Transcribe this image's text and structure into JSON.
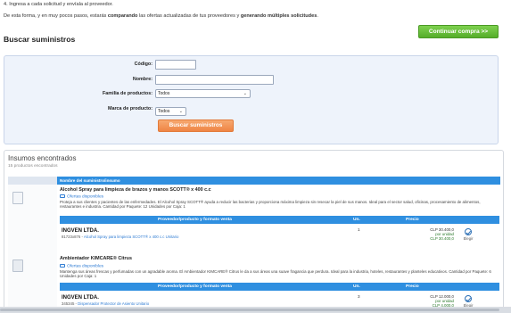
{
  "intro": {
    "step4": "4. Ingresa a cada solicitud y envíala al proveedor.",
    "line2_a": "De esta forma, y en muy pocos pasos, estarás ",
    "line2_b": "comparando",
    "line2_c": " las ofertas actualizadas de tus proveedores y ",
    "line2_d": "generando múltiples solicitudes",
    "line2_e": "."
  },
  "cta_button": "Continuar compra >>",
  "section_title": "Buscar suministros",
  "search_form": {
    "codigo_label": "Código:",
    "codigo_value": "",
    "nombre_label": "Nombre:",
    "nombre_value": "",
    "familia_label": "Familia de productos:",
    "familia_value": "Todos",
    "marca_label": "Marca de producto:",
    "marca_value": "Todos",
    "search_button": "Buscar suministros"
  },
  "results": {
    "title": "Insumos encontrados",
    "count": "15 productos encontrados",
    "column_header": "Nombre del suministro/insumo",
    "sub_headers": {
      "provider": "Proveedor/producto y formato venta",
      "unit": "Un.",
      "price": "Precio"
    },
    "products": [
      {
        "title": "Alcohol Spray para limpieza de brazos y manos SCOTT® x 400 c.c",
        "offers": "Ofertas disponibles",
        "description": "Proteja a sus clientes y pacientes de las enfermedades. El Alcohol Spray SCOTT® ayuda a reducir las bacterias y proporciona máxima limpieza sin resecar la piel de sus manos. Ideal para el sector salud, oficinas, procesamiento de alimentos, restaurantes e industria. Cantidad por Paquete: 12 Unidades por Caja: 1",
        "vendor": "INGVEN LTDA.",
        "vendor_code": "81723x876 - ",
        "vendor_product": "Alcohol Spray para limpieza SCOTT® x 400 c.c Unitario",
        "qty": "1",
        "price_main": "CLP 30.400,0",
        "price_unit_label": "por unidad",
        "price_unit": "CLP 30.400,0",
        "choose": "Elegir"
      },
      {
        "title": "Ambientador KIMCARE® Citrus",
        "offers": "Ofertas disponibles",
        "description": "Mantenga sus áreas frescas y perfumadas con un agradable aroma. El Ambientador KIMCARE® Citrus le da a sus áreas una suave fragancia que perdura. Ideal para la industria, hoteles, restaurantes y planteles educativos. Cantidad por Paquete: 6 Unidades por Caja: 1",
        "vendor": "INGVEN LTDA.",
        "vendor_code": "345345 - ",
        "vendor_product": "Dispensador Protector de Asiento Unitario",
        "qty": "3",
        "price_main": "CLP 12.000,0",
        "price_unit_label": "por unidad",
        "price_unit": "CLP 4.000,0",
        "choose": "Elegir"
      }
    ]
  },
  "colors": {
    "cta_green": "#5cb82e",
    "search_orange": "#f08a4b",
    "header_blue": "#2f8fe0",
    "form_bg": "#eef3fb"
  }
}
